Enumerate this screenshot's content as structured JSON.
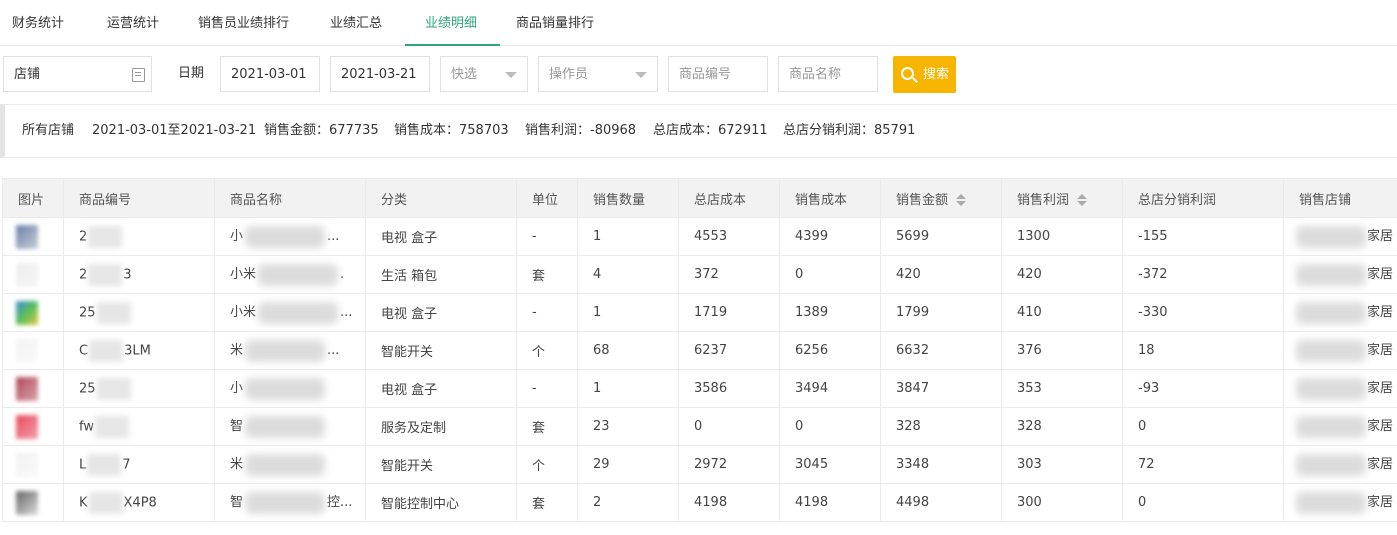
{
  "tabs": [
    "财务统计",
    "运营统计",
    "销售员业绩排行",
    "业绩汇总",
    "业绩明细",
    "商品销量排行"
  ],
  "filters": {
    "store_value": "店铺",
    "date_label": "日期",
    "date_start": "2021-03-01",
    "date_end": "2021-03-21",
    "quick_select_placeholder": "快选",
    "operator_placeholder": "操作员",
    "product_code_placeholder": "商品编号",
    "product_name_placeholder": "商品名称",
    "search_label": "搜索"
  },
  "summary": {
    "store": "所有店铺",
    "range": "2021-03-01至2021-03-21",
    "sales_amount": "销售金额：677735",
    "sales_cost": "销售成本：758703",
    "sales_profit": "销售利润：-80968",
    "hq_cost": "总店成本：672911",
    "hq_profit": "总店分销利润：85791"
  },
  "table": {
    "headers": [
      "图片",
      "商品编号",
      "商品名称",
      "分类",
      "单位",
      "销售数量",
      "总店成本",
      "销售成本",
      "销售金额",
      "销售利润",
      "总店分销利润",
      "销售店铺"
    ],
    "rows": [
      {
        "code": "2",
        "name": "小",
        "name_tail": "...",
        "category": "电视 盒子",
        "unit": "-",
        "qty": "1",
        "hq_cost": "4553",
        "cost": "4399",
        "amount": "5699",
        "profit": "1300",
        "hq_profit": "-155",
        "store": "家居"
      },
      {
        "code": "2",
        "code_tail": "3",
        "name": "小米",
        "name_tail": ".",
        "category": "生活 箱包",
        "unit": "套",
        "qty": "4",
        "hq_cost": "372",
        "cost": "0",
        "amount": "420",
        "profit": "420",
        "hq_profit": "-372",
        "store": "家居"
      },
      {
        "code": "25",
        "name": "小米",
        "name_tail": "...",
        "category": "电视 盒子",
        "unit": "-",
        "qty": "1",
        "hq_cost": "1719",
        "cost": "1389",
        "amount": "1799",
        "profit": "410",
        "hq_profit": "-330",
        "store": "家居"
      },
      {
        "code": "C",
        "code_tail": "3LM",
        "name": "米",
        "name_tail": "...",
        "category": "智能开关",
        "unit": "个",
        "qty": "68",
        "hq_cost": "6237",
        "cost": "6256",
        "amount": "6632",
        "profit": "376",
        "hq_profit": "18",
        "store": "家居"
      },
      {
        "code": "25",
        "name": "小",
        "name_tail": "",
        "category": "电视 盒子",
        "unit": "-",
        "qty": "1",
        "hq_cost": "3586",
        "cost": "3494",
        "amount": "3847",
        "profit": "353",
        "hq_profit": "-93",
        "store": "家居"
      },
      {
        "code": "fw",
        "name": "智",
        "name_tail": "",
        "category": "服务及定制",
        "unit": "套",
        "qty": "23",
        "hq_cost": "0",
        "cost": "0",
        "amount": "328",
        "profit": "328",
        "hq_profit": "0",
        "store": "家居"
      },
      {
        "code": "L",
        "code_tail": "7",
        "name": "米",
        "name_tail": "",
        "category": "智能开关",
        "unit": "个",
        "qty": "29",
        "hq_cost": "2972",
        "cost": "3045",
        "amount": "3348",
        "profit": "303",
        "hq_profit": "72",
        "store": "家居"
      },
      {
        "code": "K",
        "code_tail": "X4P8",
        "name": "智",
        "name_tail": "控...",
        "category": "智能控制中心",
        "unit": "套",
        "qty": "2",
        "hq_cost": "4198",
        "cost": "4198",
        "amount": "4498",
        "profit": "300",
        "hq_profit": "0",
        "store": "家居"
      }
    ]
  },
  "colors": {
    "accent": "#2fa57e",
    "search_button": "#f7b500",
    "header_bg": "#f2f2f2"
  },
  "icons": {
    "store": "store-picker-icon",
    "search": "search-icon",
    "dropdown": "chevron-down-icon",
    "sort": "sort-icon"
  }
}
